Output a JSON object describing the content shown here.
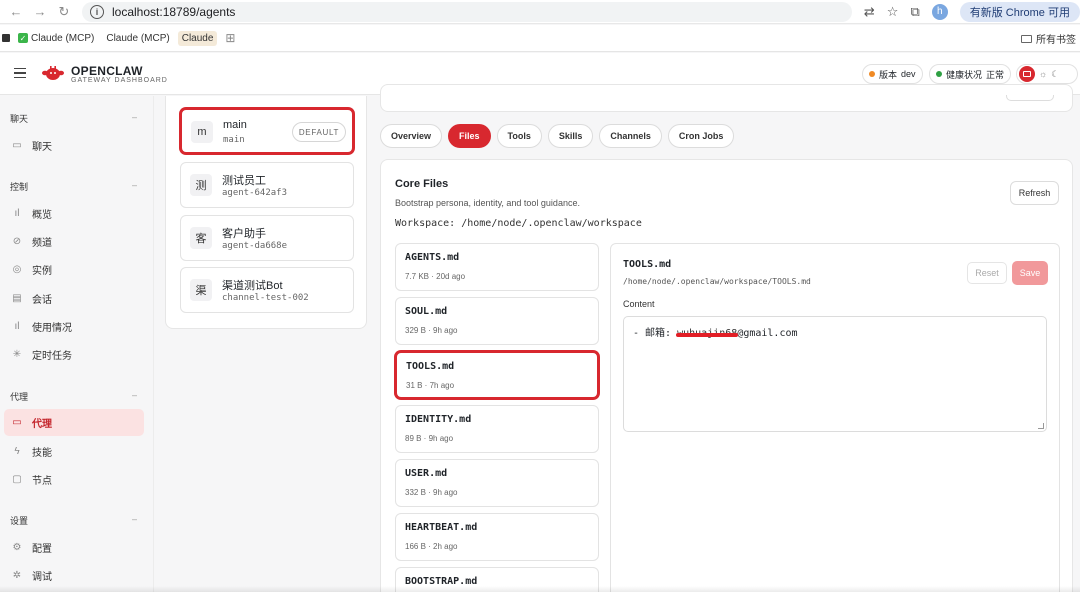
{
  "browser": {
    "url": "localhost:18789/agents",
    "update_label": "有新版 Chrome 可用",
    "profile_initial": "h",
    "bookmarks": [
      "Claude (MCP)",
      "Claude (MCP)",
      "Claude"
    ],
    "bookmarks_right": "所有书签"
  },
  "header": {
    "brand": "OPENCLAW",
    "subtitle": "GATEWAY DASHBOARD",
    "version_label": "版本",
    "version_value": "dev",
    "health_label": "健康状况",
    "health_value": "正常",
    "version_dot_color": "#f08a24",
    "health_dot_color": "#2ea043"
  },
  "sidebar": {
    "sections": [
      {
        "title": "聊天",
        "items": [
          {
            "label": "聊天",
            "icon": "chat-icon"
          }
        ]
      },
      {
        "title": "控制",
        "items": [
          {
            "label": "概览",
            "icon": "bar-chart-icon"
          },
          {
            "label": "频道",
            "icon": "link-icon"
          },
          {
            "label": "实例",
            "icon": "radio-icon"
          },
          {
            "label": "会话",
            "icon": "document-icon"
          },
          {
            "label": "使用情况",
            "icon": "bar-chart-icon"
          },
          {
            "label": "定时任务",
            "icon": "loader-icon"
          }
        ]
      },
      {
        "title": "代理",
        "items": [
          {
            "label": "代理",
            "icon": "folder-icon"
          },
          {
            "label": "技能",
            "icon": "lightning-icon"
          },
          {
            "label": "节点",
            "icon": "monitor-icon"
          }
        ]
      },
      {
        "title": "设置",
        "items": [
          {
            "label": "配置",
            "icon": "gear-icon"
          },
          {
            "label": "调试",
            "icon": "bug-icon"
          }
        ]
      }
    ]
  },
  "agents": [
    {
      "avatar": "m",
      "name": "main",
      "id": "main",
      "badge": "DEFAULT"
    },
    {
      "avatar": "测",
      "name": "测试员工",
      "id": "agent-642af3"
    },
    {
      "avatar": "客",
      "name": "客户助手",
      "id": "agent-da668e"
    },
    {
      "avatar": "渠",
      "name": "渠道测试Bot",
      "id": "channel-test-002"
    }
  ],
  "tabs": [
    "Overview",
    "Files",
    "Tools",
    "Skills",
    "Channels",
    "Cron Jobs"
  ],
  "core_files": {
    "title": "Core Files",
    "subtitle": "Bootstrap persona, identity, and tool guidance.",
    "workspace": "Workspace: /home/node/.openclaw/workspace",
    "refresh_label": "Refresh",
    "files": [
      {
        "name": "AGENTS.md",
        "meta": "7.7 KB · 20d ago"
      },
      {
        "name": "SOUL.md",
        "meta": "329 B · 9h ago"
      },
      {
        "name": "TOOLS.md",
        "meta": "31 B · 7h ago"
      },
      {
        "name": "IDENTITY.md",
        "meta": "89 B · 9h ago"
      },
      {
        "name": "USER.md",
        "meta": "332 B · 9h ago"
      },
      {
        "name": "HEARTBEAT.md",
        "meta": "166 B · 2h ago"
      },
      {
        "name": "BOOTSTRAP.md",
        "meta": ""
      }
    ]
  },
  "editor": {
    "file_name": "TOOLS.md",
    "path": "/home/node/.openclaw/workspace/TOOLS.md",
    "reset_label": "Reset",
    "save_label": "Save",
    "content_label": "Content",
    "content_prefix": "- 邮箱: ",
    "content_redacted": "wuhuajin68",
    "content_suffix": "@gmail.com"
  },
  "colors": {
    "accent": "#d8282f",
    "active_bg": "#fbe2e2"
  }
}
